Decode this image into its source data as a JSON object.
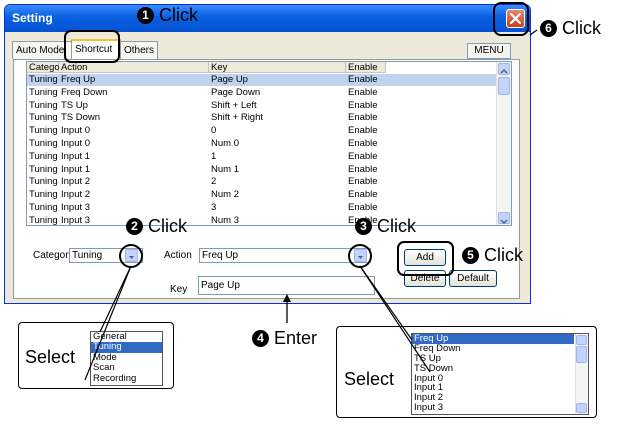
{
  "window": {
    "title": "Setting",
    "close_icon": "close-icon"
  },
  "tabs": [
    {
      "label": "Auto Mode",
      "active": false
    },
    {
      "label": "Shortcut",
      "active": true
    },
    {
      "label": "Others",
      "active": false
    }
  ],
  "menu_button": "MENU",
  "table": {
    "headers": [
      "Category",
      "Action",
      "Key",
      "Enable"
    ],
    "rows": [
      [
        "Tuning",
        "Freq Up",
        "Page Up",
        "Enable"
      ],
      [
        "Tuning",
        "Freq Down",
        "Page Down",
        "Enable"
      ],
      [
        "Tuning",
        "TS Up",
        "Shift + Left",
        "Enable"
      ],
      [
        "Tuning",
        "TS Down",
        "Shift + Right",
        "Enable"
      ],
      [
        "Tuning",
        "Input 0",
        "0",
        "Enable"
      ],
      [
        "Tuning",
        "Input 0",
        "Num 0",
        "Enable"
      ],
      [
        "Tuning",
        "Input 1",
        "1",
        "Enable"
      ],
      [
        "Tuning",
        "Input 1",
        "Num 1",
        "Enable"
      ],
      [
        "Tuning",
        "Input 2",
        "2",
        "Enable"
      ],
      [
        "Tuning",
        "Input 2",
        "Num 2",
        "Enable"
      ],
      [
        "Tuning",
        "Input 3",
        "3",
        "Enable"
      ],
      [
        "Tuning",
        "Input 3",
        "Num 3",
        "Enable"
      ]
    ],
    "selected_row": 0
  },
  "form": {
    "category_label": "Category",
    "category_value": "Tuning",
    "action_label": "Action",
    "action_value": "Freq Up",
    "key_label": "Key",
    "key_value": "Page Up",
    "add_button": "Add",
    "delete_button": "Delete",
    "default_button": "Default"
  },
  "callouts": {
    "c1": {
      "num": "1",
      "text": "Click"
    },
    "c2": {
      "num": "2",
      "text": "Click"
    },
    "c3": {
      "num": "3",
      "text": "Click"
    },
    "c4": {
      "num": "4",
      "text": "Enter"
    },
    "c5": {
      "num": "5",
      "text": "Click"
    },
    "c6": {
      "num": "6",
      "text": "Click"
    }
  },
  "category_dropdown": {
    "label": "Select",
    "options": [
      "General",
      "Tuning",
      "Mode",
      "Scan",
      "Recording"
    ],
    "selected_index": 1
  },
  "action_dropdown": {
    "label": "Select",
    "options": [
      "Freq Up",
      "Freq Down",
      "TS Up",
      "TS Down",
      "Input 0",
      "Input 1",
      "Input 2",
      "Input 3"
    ],
    "selected_index": 0
  },
  "colors": {
    "titlebar": "#0A5FE0",
    "selection": "#316AC5",
    "row_highlight": "#C1D2EE",
    "window_bg": "#ECE9D8"
  }
}
